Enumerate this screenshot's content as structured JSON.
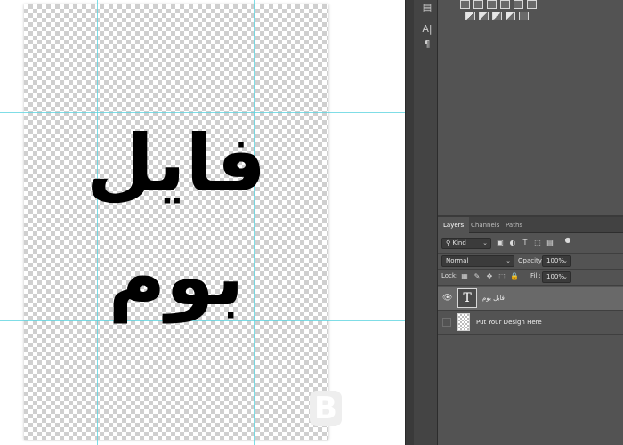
{
  "canvas": {
    "art_text_lines": [
      "فایل",
      "بوم"
    ],
    "watermark_letter": "B"
  },
  "tool_strip": {
    "icons": [
      "text-tool-icon",
      "paragraph-icon"
    ]
  },
  "layers_panel": {
    "tabs": [
      {
        "label": "Layers",
        "active": true
      },
      {
        "label": "Channels",
        "active": false
      },
      {
        "label": "Paths",
        "active": false
      }
    ],
    "filter": {
      "kind_label": "Kind"
    },
    "blend_mode": "Normal",
    "opacity_label": "Opacity:",
    "opacity_value": "100%",
    "lock_label": "Lock:",
    "fill_label": "Fill:",
    "fill_value": "100%",
    "layers": [
      {
        "name": "فایل بوم",
        "type": "text",
        "visible": true,
        "selected": true
      },
      {
        "name": "Put Your Design Here",
        "type": "image",
        "visible": false,
        "selected": false
      }
    ]
  },
  "colors": {
    "panel_bg": "#535353",
    "panel_dark": "#424242",
    "guide": "#5fd4e0",
    "selected_row": "#696969"
  }
}
